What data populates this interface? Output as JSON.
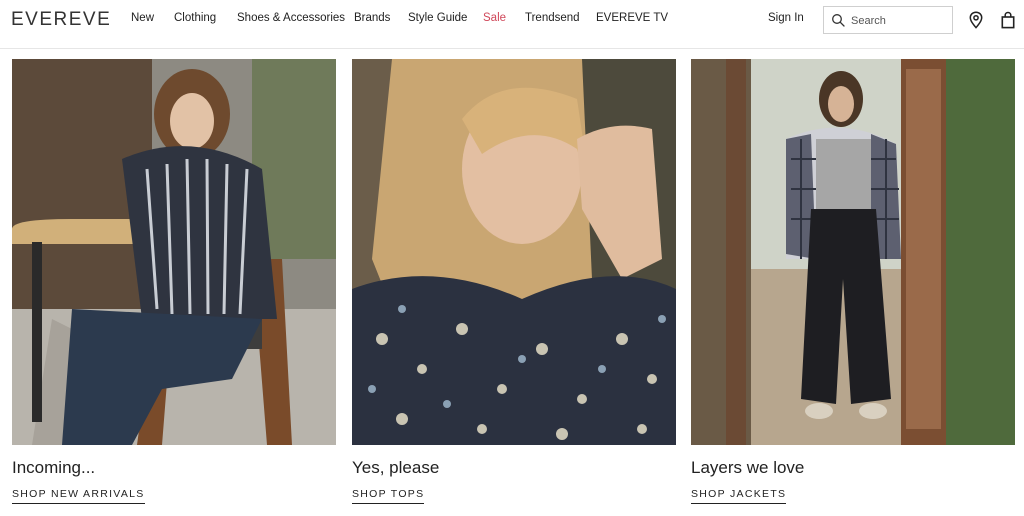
{
  "brand": {
    "logo": "EVEREVE"
  },
  "nav": {
    "items": [
      {
        "label": "New"
      },
      {
        "label": "Clothing"
      },
      {
        "label": "Shoes & Accessories"
      },
      {
        "label": "Brands"
      },
      {
        "label": "Style Guide"
      },
      {
        "label": "Sale"
      },
      {
        "label": "Trendsend"
      },
      {
        "label": "EVEREVE TV"
      }
    ]
  },
  "account": {
    "signin": "Sign In"
  },
  "search": {
    "placeholder": "Search"
  },
  "icons": {
    "search": "search-icon",
    "location": "location-pin-icon",
    "bag": "shopping-bag-icon"
  },
  "colors": {
    "sale": "#d0485a",
    "text": "#222222"
  },
  "cards": [
    {
      "title": "Incoming...",
      "link": "SHOP NEW ARRIVALS"
    },
    {
      "title": "Yes, please",
      "link": "SHOP TOPS"
    },
    {
      "title": "Layers we love",
      "link": "SHOP JACKETS"
    }
  ]
}
